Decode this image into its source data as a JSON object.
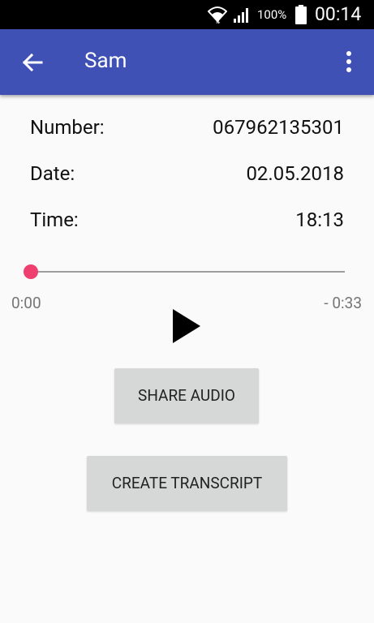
{
  "status_bar": {
    "battery_percent": "100%",
    "time": "00:14",
    "icons": [
      "wifi-icon",
      "signal-icon",
      "battery-icon"
    ]
  },
  "app_bar": {
    "title": "Sam",
    "back_icon": "arrow-back-icon",
    "menu_icon": "more-vert-icon",
    "color": "#3F51B5"
  },
  "details": {
    "number_label": "Number:",
    "number_value": "067962135301",
    "date_label": "Date:",
    "date_value": "02.05.2018",
    "time_label": "Time:",
    "time_value": "18:13"
  },
  "player": {
    "position_fraction": 0,
    "elapsed": "0:00",
    "remaining": "- 0:33",
    "play_icon": "play-icon",
    "accent": "#EE3F6F"
  },
  "actions": {
    "share_label": "SHARE AUDIO",
    "transcript_label": "CREATE TRANSCRIPT"
  }
}
